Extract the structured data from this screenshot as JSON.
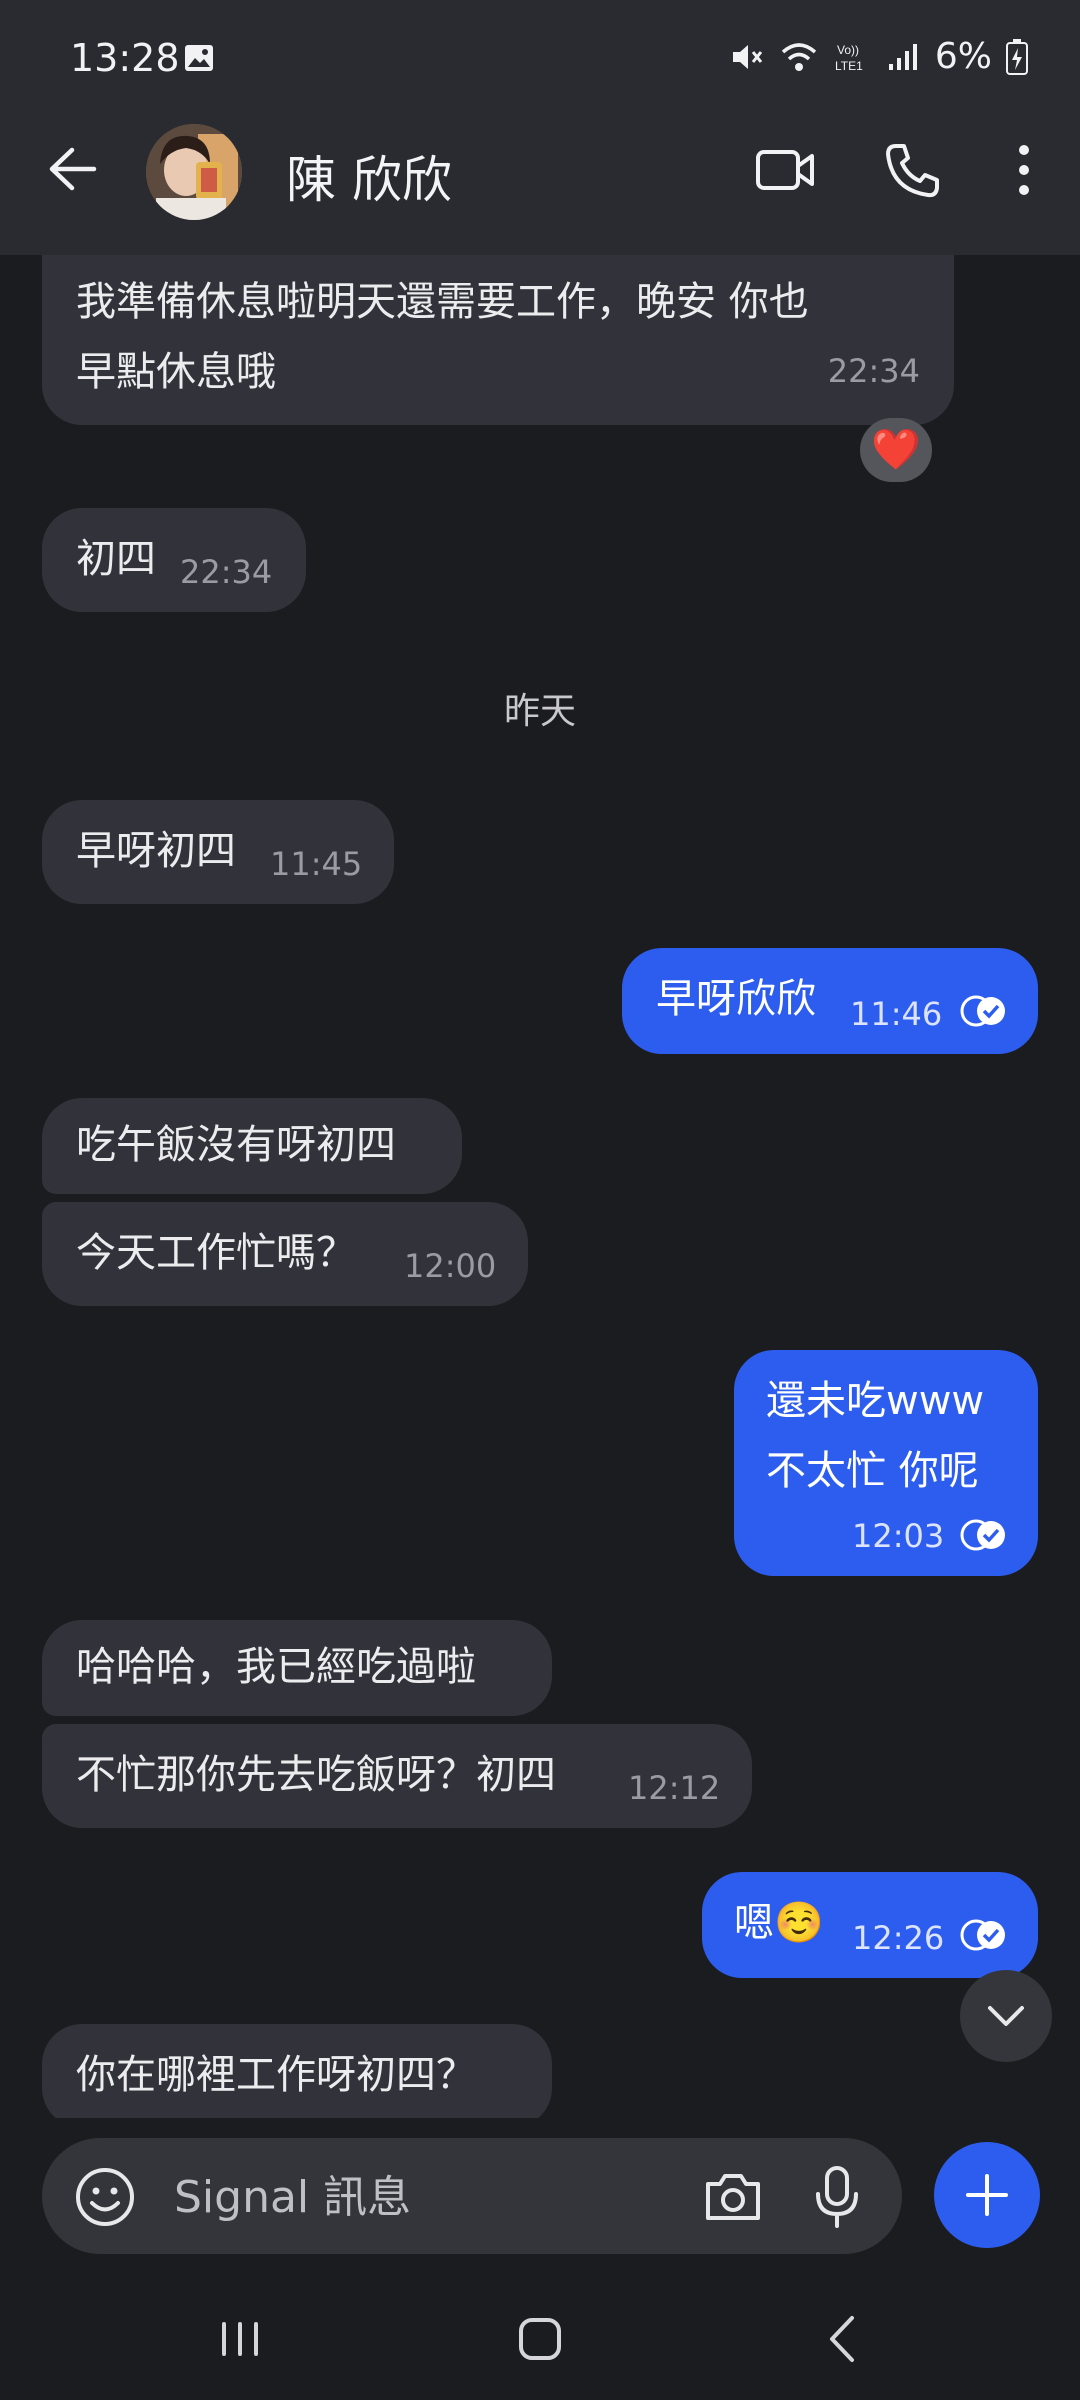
{
  "status": {
    "time": "13:28",
    "battery": "6%"
  },
  "header": {
    "contact_name": "陳 欣欣"
  },
  "messages": [
    {
      "dir": "in",
      "lines": [
        "我準備休息啦明天還需要工作，晚安 你也",
        "早點休息哦"
      ],
      "time": "22:34",
      "reaction": "❤️"
    },
    {
      "dir": "in",
      "text": "初四",
      "time": "22:34"
    },
    {
      "day_label": "昨天"
    },
    {
      "dir": "in",
      "text": "早呀初四",
      "time": "11:45"
    },
    {
      "dir": "out",
      "text": "早呀欣欣",
      "time": "11:46"
    },
    {
      "dir": "in",
      "text": "吃午飯沒有呀初四"
    },
    {
      "dir": "in",
      "text": "今天工作忙嗎？",
      "time": "12:00"
    },
    {
      "dir": "out",
      "lines": [
        "還未吃www",
        "不太忙 你呢"
      ],
      "time": "12:03"
    },
    {
      "dir": "in",
      "text": "哈哈哈，我已經吃過啦"
    },
    {
      "dir": "in",
      "text": "不忙那你先去吃飯呀？初四",
      "time": "12:12"
    },
    {
      "dir": "out",
      "text": "嗯☺️",
      "time": "12:26"
    },
    {
      "dir": "in",
      "text": "你在哪裡工作呀初四？"
    }
  ],
  "composer": {
    "placeholder": "Signal 訊息"
  },
  "colors": {
    "outgoing": "#2d5dee",
    "incoming": "#32333a",
    "background": "#1b1c1f"
  }
}
